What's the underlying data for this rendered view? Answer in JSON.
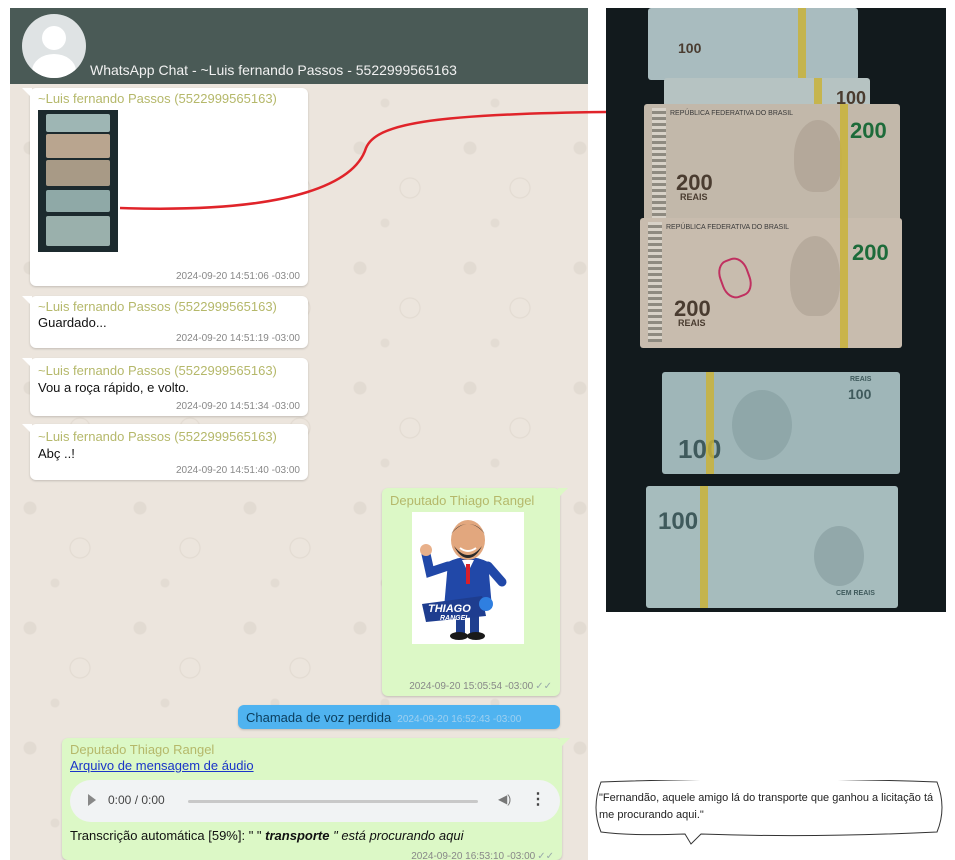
{
  "header": {
    "title": "WhatsApp Chat - ~Luis fernando Passos - 5522999565163"
  },
  "messages": [
    {
      "sender": "~Luis fernando Passos (5522999565163)",
      "text": "",
      "timestamp": "2024-09-20 14:51:06 -03:00"
    },
    {
      "sender": "~Luis fernando Passos (5522999565163)",
      "text": "Guardado...",
      "timestamp": "2024-09-20 14:51:19 -03:00"
    },
    {
      "sender": "~Luis fernando Passos (5522999565163)",
      "text": "Vou a roça rápido, e volto.",
      "timestamp": "2024-09-20 14:51:34 -03:00"
    },
    {
      "sender": "~Luis fernando Passos (5522999565163)",
      "text": "Abç ..!",
      "timestamp": "2024-09-20 14:51:40 -03:00"
    },
    {
      "sender": "Deputado Thiago Rangel",
      "text": "",
      "timestamp": "2024-09-20 15:05:54 -03:00"
    },
    {
      "sender": "",
      "text": "Chamada de voz perdida",
      "timestamp": "2024-09-20 16:52:43 -03:00"
    },
    {
      "sender": "Deputado Thiago Rangel",
      "text": "",
      "timestamp": "2024-09-20 16:53:10 -03:00"
    }
  ],
  "sticker": {
    "line1": "THIAGO",
    "line2": "RANGEL"
  },
  "audio": {
    "link": "Arquivo de mensagem de áudio",
    "time": "0:00 / 0:00",
    "transcript_prefix": "Transcrição automática [59%]: \" \"",
    "transcript_word": "transporte",
    "transcript_suffix": "\" está procurando aqui"
  },
  "photo": {
    "notes": [
      {
        "value": "100",
        "label": ""
      },
      {
        "value": "100",
        "label": ""
      },
      {
        "value": "200",
        "label": "REAIS",
        "issuer": "REPÚBLICA FEDERATIVA DO BRASIL"
      },
      {
        "value": "200",
        "label": "REAIS",
        "issuer": "REPÚBLICA FEDERATIVA DO BRASIL"
      },
      {
        "value": "100",
        "label": "REAIS"
      },
      {
        "value": "100",
        "label": "CEM REAIS"
      }
    ]
  },
  "callout": {
    "text": "\"Fernandão, aquele amigo lá do transporte que ganhou a licitação tá me procurando aqui.\""
  },
  "colors": {
    "header": "#4a5a56",
    "chat_bg": "#ece5dd",
    "incoming": "#ffffff",
    "outgoing": "#dcf8c6",
    "call": "#4fb3f0",
    "connector": "#e0242a"
  }
}
